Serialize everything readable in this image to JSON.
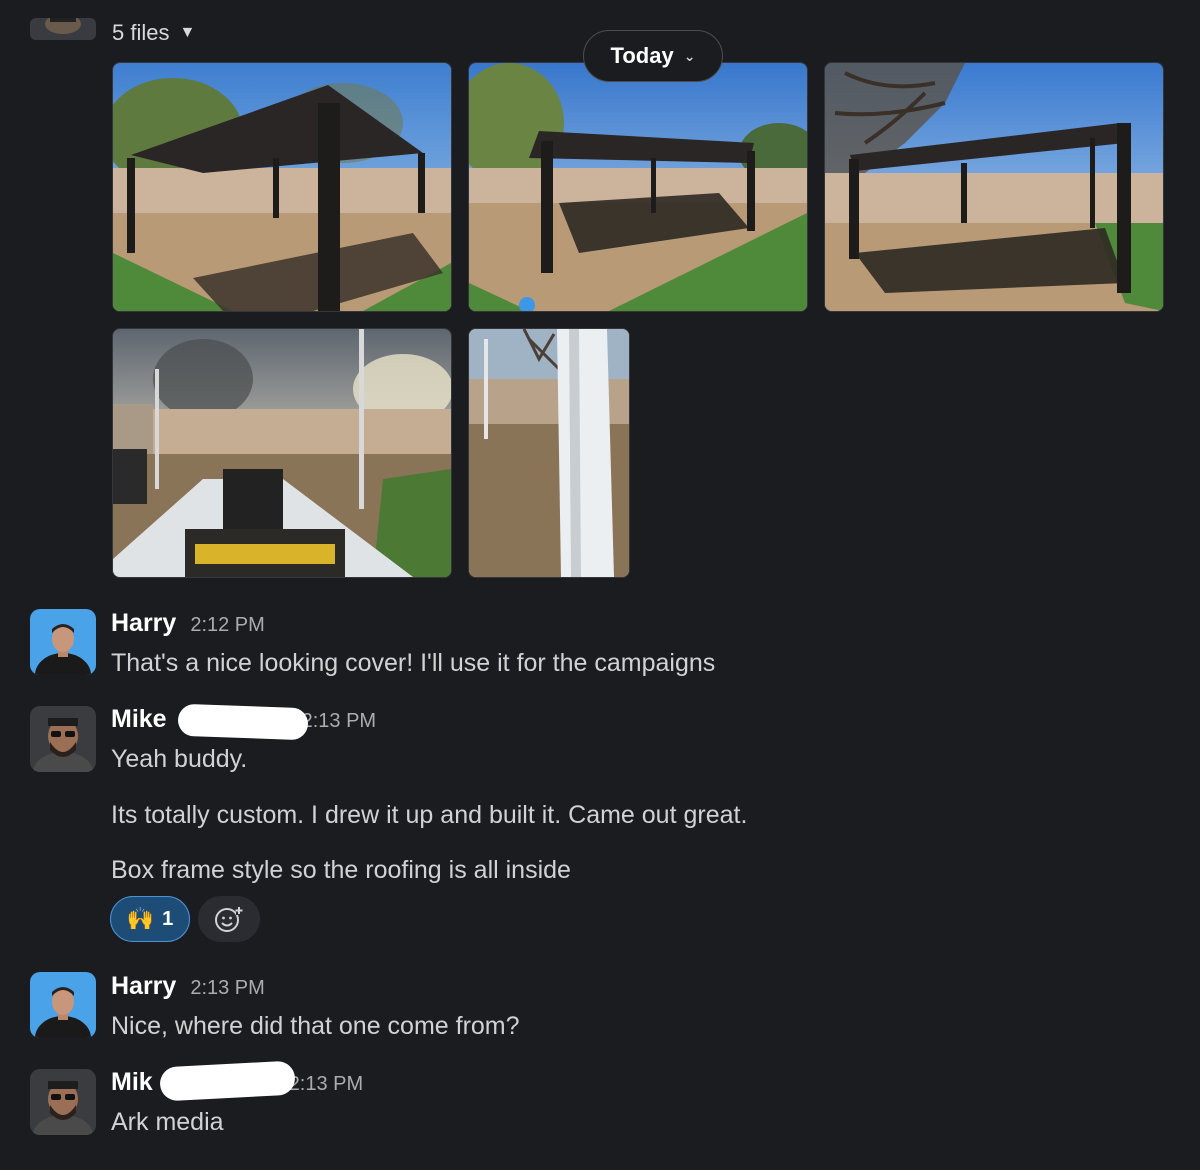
{
  "files_header": {
    "count_label": "5 files",
    "caret": "▼",
    "today_label": "Today",
    "today_chevron": "⌄"
  },
  "photos": [
    {
      "subject": "pergola-backyard-1"
    },
    {
      "subject": "pergola-backyard-2"
    },
    {
      "subject": "pergola-backyard-3"
    },
    {
      "subject": "drill-on-beam"
    },
    {
      "subject": "white-post-closeup"
    }
  ],
  "messages": [
    {
      "sender": "Harry",
      "time": "2:12 PM",
      "text": "That's a nice looking cover! I'll use it for the campaigns"
    },
    {
      "sender": "Mike",
      "time": "2:13 PM",
      "lines": [
        "Yeah buddy.",
        "Its totally custom. I drew it up and built it. Came out great.",
        "Box frame style so the roofing is all inside"
      ]
    },
    {
      "sender": "Harry",
      "time": "2:13 PM",
      "text": "Nice, where did that one come from?"
    },
    {
      "sender": "Mik",
      "time": "2:13 PM",
      "text": "Ark media"
    }
  ],
  "reaction": {
    "emoji": "🙌",
    "count": "1"
  },
  "colors": {
    "background": "#1b1c20",
    "reaction_bg": "#1d4c77",
    "reaction_border": "#4b95d6",
    "name": "#ffffff",
    "text": "#d1d2d3",
    "time": "#abacae"
  },
  "icons": {
    "add_reaction": "add-reaction-icon",
    "caret": "caret-down-icon",
    "chevron": "chevron-down-icon"
  }
}
